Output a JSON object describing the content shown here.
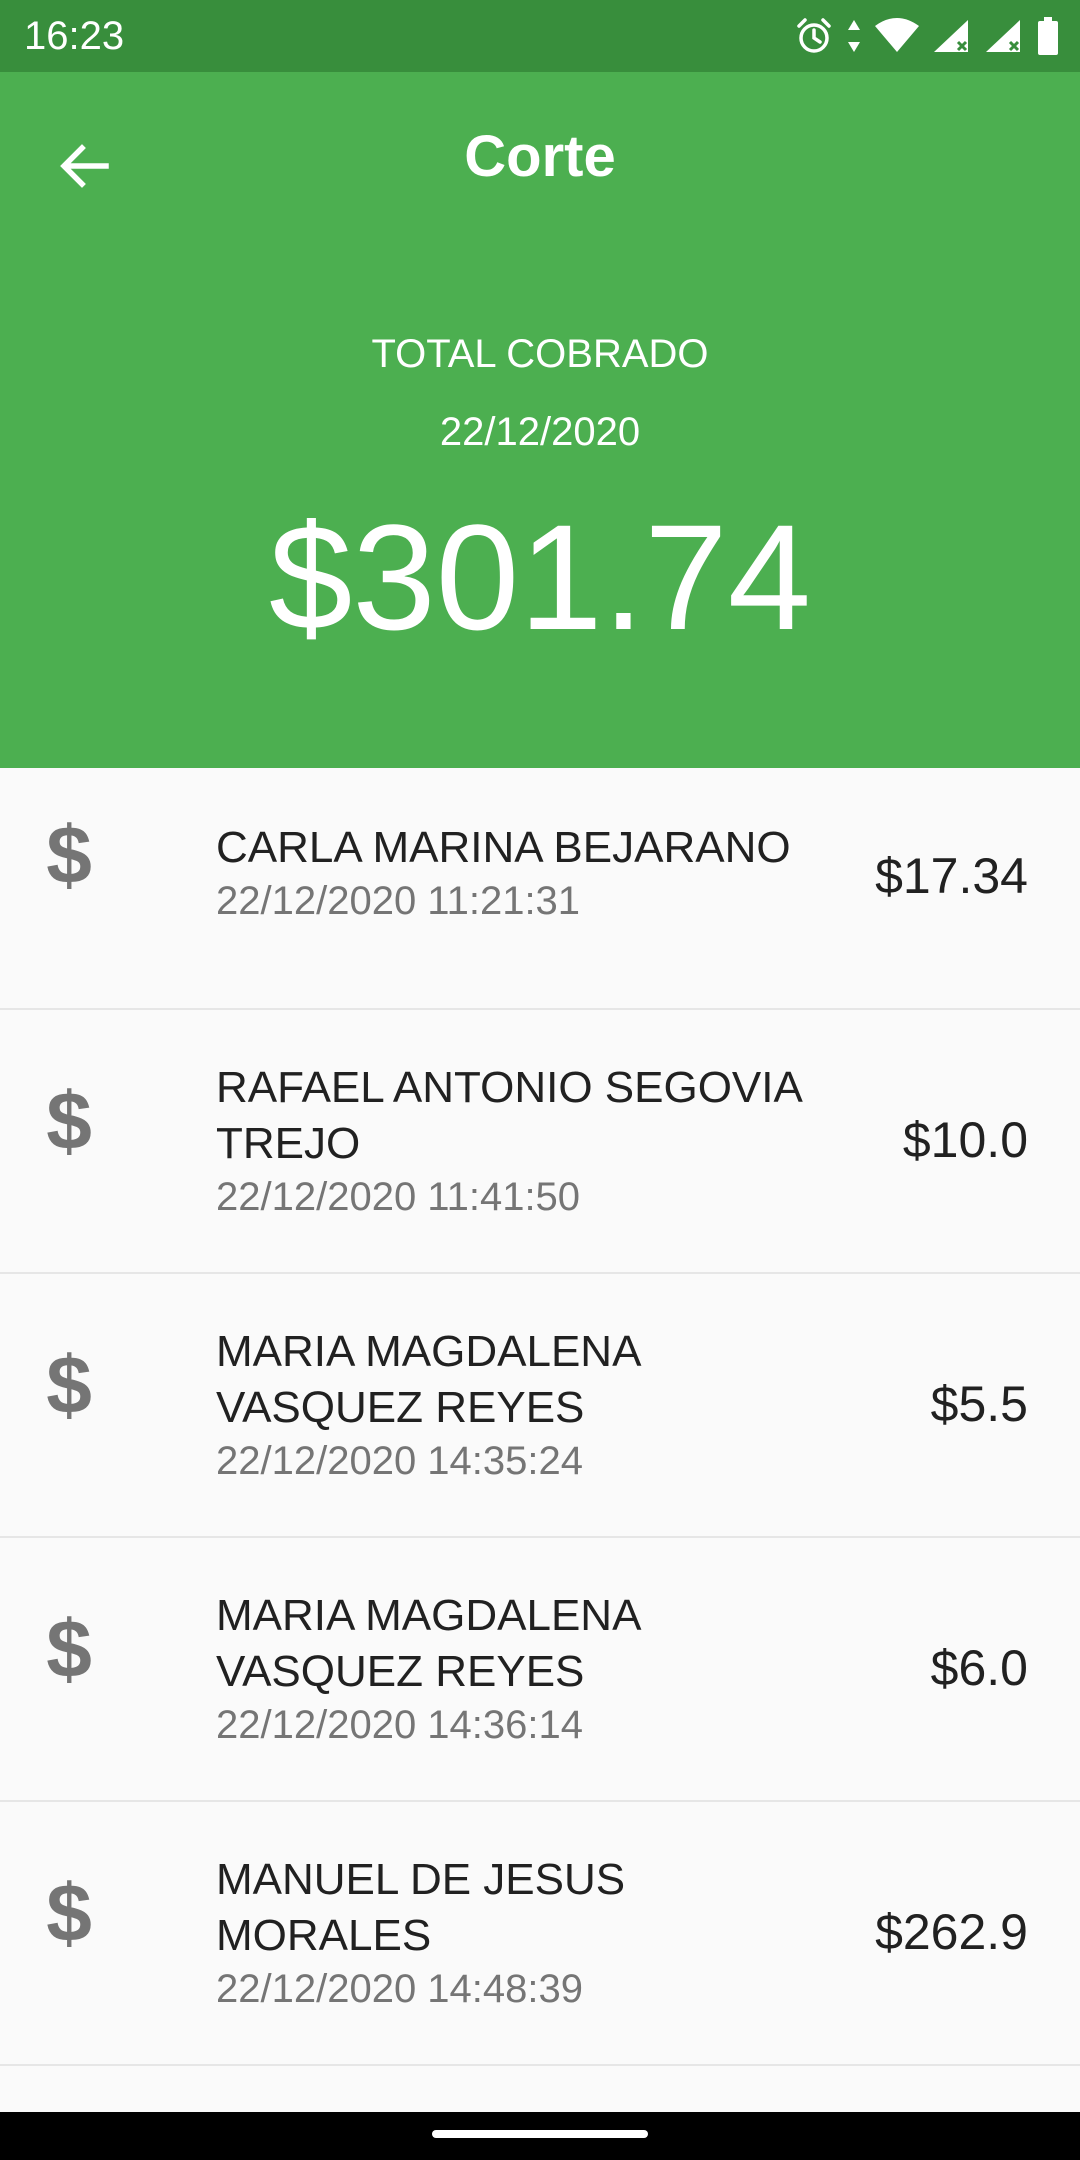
{
  "status_bar": {
    "time": "16:23",
    "icons": [
      "alarm-icon",
      "data-arrows-icon",
      "wifi-icon",
      "signal-icon",
      "signal-icon",
      "battery-icon"
    ]
  },
  "app_bar": {
    "back_icon": "arrow-back-icon",
    "title": "Corte",
    "total_label": "TOTAL COBRADO",
    "total_date": "22/12/2020",
    "total_amount": "$301.74",
    "background_color": "#4caf50",
    "status_color": "#388e3c"
  },
  "payments": [
    {
      "icon": "dollar-icon",
      "name": "CARLA MARINA BEJARANO",
      "datetime": "22/12/2020 11:21:31",
      "amount": "$17.34"
    },
    {
      "icon": "dollar-icon",
      "name": "RAFAEL ANTONIO SEGOVIA TREJO",
      "datetime": "22/12/2020 11:41:50",
      "amount": "$10.0"
    },
    {
      "icon": "dollar-icon",
      "name": "MARIA MAGDALENA VASQUEZ REYES",
      "datetime": "22/12/2020 14:35:24",
      "amount": "$5.5"
    },
    {
      "icon": "dollar-icon",
      "name": "MARIA MAGDALENA VASQUEZ REYES",
      "datetime": "22/12/2020 14:36:14",
      "amount": "$6.0"
    },
    {
      "icon": "dollar-icon",
      "name": "MANUEL DE JESUS MORALES",
      "datetime": "22/12/2020 14:48:39",
      "amount": "$262.9"
    }
  ],
  "row_icon_glyph": "$"
}
